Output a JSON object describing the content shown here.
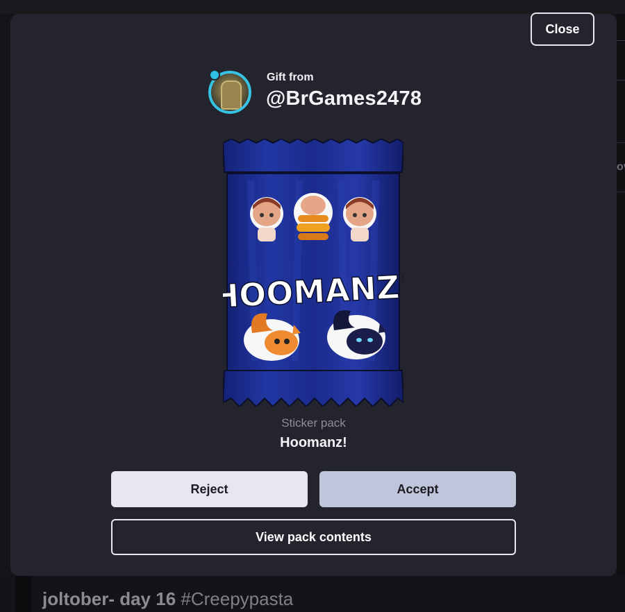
{
  "backdrop": {
    "post_title": "joltober- day 16",
    "post_tag": "#Creepypasta",
    "edge_label": "ov"
  },
  "modal": {
    "close_label": "Close",
    "gift_label": "Gift from",
    "sender": "@BrGames2478",
    "pack": {
      "type_label": "Sticker pack",
      "name": "Hoomanz!",
      "art_title": "HOOMANZ!",
      "colors": {
        "pack_blue": "#1d2f8f",
        "pack_dark": "#0f1a5c",
        "avatar_ring": "#36c3e4"
      }
    },
    "buttons": {
      "reject": "Reject",
      "accept": "Accept",
      "view_contents": "View pack contents"
    }
  }
}
